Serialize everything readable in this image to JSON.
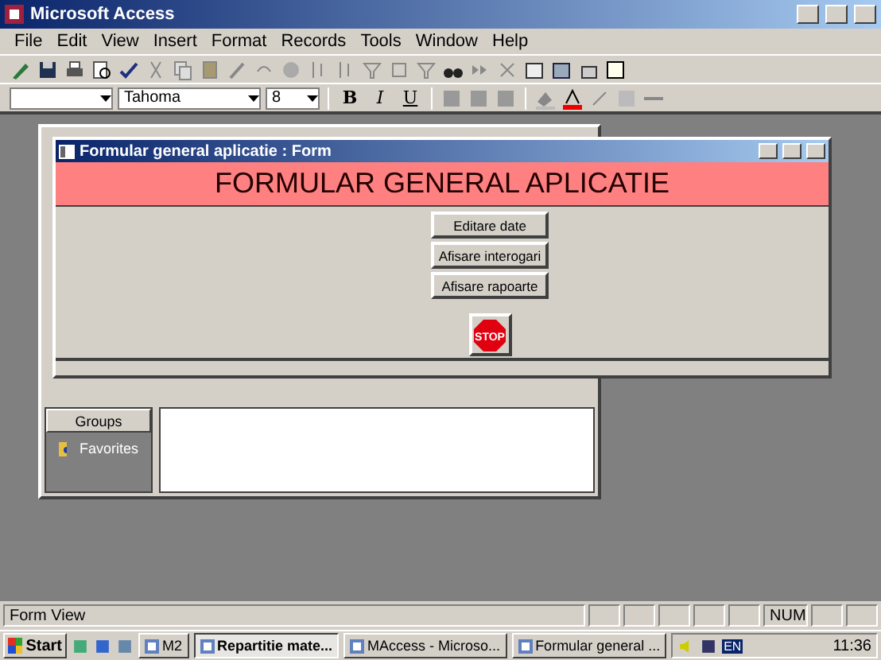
{
  "app": {
    "title": "Microsoft Access"
  },
  "menu": [
    "File",
    "Edit",
    "View",
    "Insert",
    "Format",
    "Records",
    "Tools",
    "Window",
    "Help"
  ],
  "format_toolbar": {
    "font": "Tahoma",
    "size": "8",
    "styles": [
      "B",
      "I",
      "U"
    ]
  },
  "database_window": {
    "groups_button": "Groups",
    "groups": [
      {
        "label": "Favorites"
      }
    ]
  },
  "form_window": {
    "title": "Formular general aplicatie : Form",
    "header": "FORMULAR GENERAL APLICATIE",
    "buttons": [
      "Editare date",
      "Afisare interogari",
      "Afisare rapoarte"
    ],
    "stop_label": "STOP"
  },
  "status_bar": {
    "text": "Form View",
    "num": "NUM"
  },
  "taskbar": {
    "start": "Start",
    "tasks": [
      {
        "label": "M2",
        "selected": false
      },
      {
        "label": "Repartitie mate...",
        "selected": true
      },
      {
        "label": "MAccess - Microso...",
        "selected": false
      },
      {
        "label": "Formular general ...",
        "selected": false
      }
    ],
    "language": "EN",
    "clock": "11:36"
  }
}
